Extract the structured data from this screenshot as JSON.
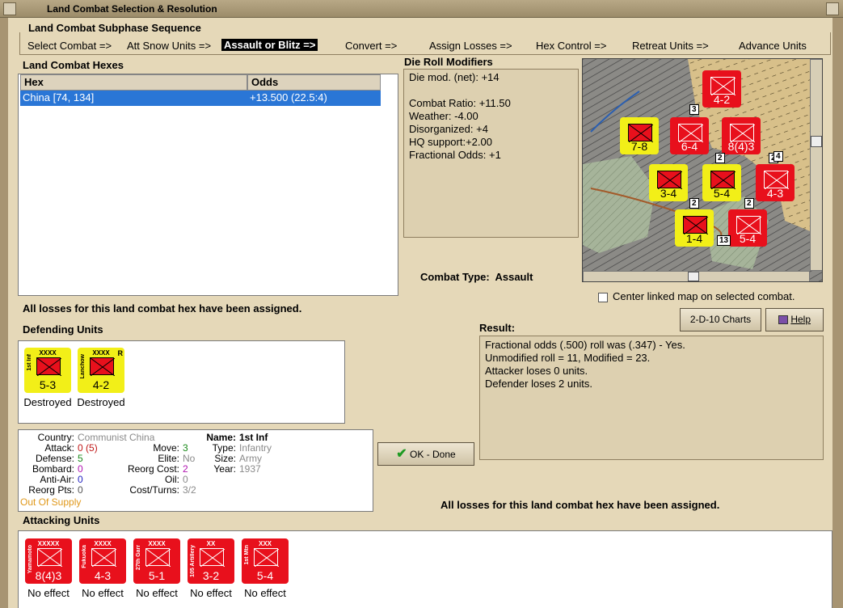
{
  "window": {
    "title": "Land Combat Selection & Resolution"
  },
  "subphase": {
    "heading": "Land Combat Subphase Sequence",
    "steps": [
      "Select Combat =>",
      "Att Snow Units =>",
      "Assault or Blitz =>",
      "Convert =>",
      "Assign Losses =>",
      "Hex Control =>",
      "Retreat Units =>",
      "Advance Units"
    ]
  },
  "hexes": {
    "heading": "Land Combat Hexes",
    "columns": [
      "Hex",
      "Odds"
    ],
    "rows": [
      {
        "hex": "China [74, 134]",
        "odds": "+13.500 (22.5:4)"
      }
    ]
  },
  "modifiers": {
    "heading": "Die Roll Modifiers",
    "lines": [
      "Die mod. (net): +14",
      "Combat Ratio: +11.50",
      "Weather: -4.00",
      "Disorganized: +4",
      "HQ support:+2.00",
      "Fractional Odds: +1"
    ]
  },
  "combat_type": {
    "label": "Combat Type:",
    "value": "Assault"
  },
  "center_map": {
    "label": "Center linked map on selected combat."
  },
  "losses_msg": "All losses for this land combat hex have been assigned.",
  "buttons": {
    "charts": "2-D-10 Charts",
    "help": "Help",
    "ok": "OK - Done"
  },
  "defending": {
    "heading": "Defending Units",
    "units": [
      {
        "name": "1st Inf",
        "size": "XXXX",
        "strength": "5-3",
        "status": "Destroyed",
        "mark": ""
      },
      {
        "name": "Lanchow",
        "size": "XXXX",
        "strength": "4-2",
        "status": "Destroyed",
        "mark": "R"
      }
    ]
  },
  "result": {
    "heading": "Result:",
    "lines": [
      "Fractional odds (.500) roll was (.347)  - Yes.",
      "Unmodified roll = 11, Modified = 23.",
      "Attacker loses 0 units.",
      "Defender loses 2 units."
    ]
  },
  "unit_info": {
    "country_label": "Country:",
    "country": "Communist China",
    "attack_label": "Attack:",
    "attack": "0",
    "attack_extra": "(5)",
    "defense_label": "Defense:",
    "defense": "5",
    "bombard_label": "Bombard:",
    "bombard": "0",
    "antiair_label": "Anti-Air:",
    "antiair": "0",
    "reorg_pts_label": "Reorg Pts:",
    "reorg_pts": "0",
    "supply": "Out Of Supply",
    "move_label": "Move:",
    "move": "3",
    "elite_label": "Elite:",
    "elite": "No",
    "reorg_cost_label": "Reorg Cost:",
    "reorg_cost": "2",
    "oil_label": "Oil:",
    "oil": "0",
    "cost_turns_label": "Cost/Turns:",
    "cost_turns": "3/2",
    "name_label": "Name:",
    "name": "1st Inf",
    "type_label": "Type:",
    "type": "Infantry",
    "size_label": "Size:",
    "size": "Army",
    "year_label": "Year:",
    "year": "1937"
  },
  "attacking": {
    "heading": "Attacking Units",
    "units": [
      {
        "name": "Yamamoto",
        "size": "XXXXX",
        "strength": "8(4)3",
        "status": "No effect"
      },
      {
        "name": "Fukuoka",
        "size": "XXXX",
        "strength": "4-3",
        "status": "No effect"
      },
      {
        "name": "27th Garr",
        "size": "XXXX",
        "strength": "5-1",
        "status": "No effect"
      },
      {
        "name": "105 Artillery",
        "size": "XX",
        "strength": "3-2",
        "status": "No effect"
      },
      {
        "name": "1st Mtn",
        "size": "XXX",
        "strength": "5-4",
        "status": "No effect"
      }
    ]
  },
  "map_units": [
    {
      "strength": "4-2",
      "color": "red"
    },
    {
      "strength": "7-8",
      "color": "yellow"
    },
    {
      "strength": "6-4",
      "color": "red"
    },
    {
      "strength": "8(4)3",
      "color": "red"
    },
    {
      "strength": "3-4",
      "color": "yellow"
    },
    {
      "strength": "5-4",
      "color": "yellow"
    },
    {
      "strength": "4-3",
      "color": "red"
    },
    {
      "strength": "1-4",
      "color": "yellow"
    },
    {
      "strength": "5-4",
      "color": "red"
    }
  ],
  "map_stack_counts": [
    "3",
    "2",
    "2",
    "4",
    "2",
    "2",
    "13"
  ],
  "colors": {
    "accent": "#2a76d6",
    "red_unit": "#e8101c",
    "yellow_unit": "#f2ef18",
    "bg": "#e5d8b8"
  }
}
